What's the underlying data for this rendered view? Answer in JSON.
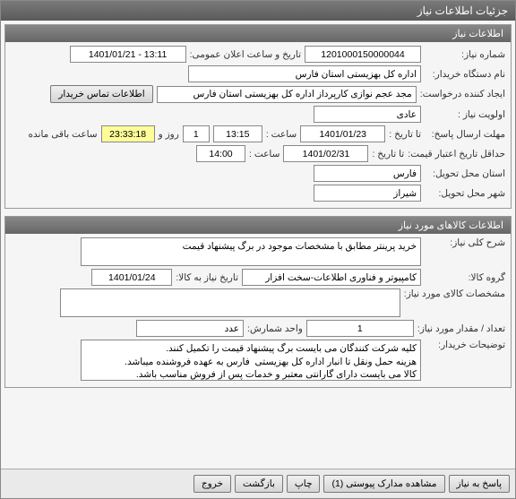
{
  "window": {
    "title": "جزئیات اطلاعات نیاز"
  },
  "section1": {
    "header": "اطلاعات نیاز",
    "need_number_label": "شماره نیاز:",
    "need_number": "1201000150000044",
    "announce_label": "تاریخ و ساعت اعلان عمومی:",
    "announce_value": "13:11 - 1401/01/21",
    "buyer_org_label": "نام دستگاه خریدار:",
    "buyer_org": "اداره کل بهزیستی استان فارس",
    "requester_label": "ایجاد کننده درخواست:",
    "requester": "مجد عجم نوازی کارپرداز اداره کل بهزیستی استان فارس",
    "contact_btn": "اطلاعات تماس خریدار",
    "priority_label": "اولویت نیاز :",
    "priority": "عادی",
    "reply_deadline_label": "مهلت ارسال پاسخ:",
    "to_date_label": "تا تاریخ :",
    "reply_date": "1401/01/23",
    "time_label": "ساعت :",
    "reply_time": "13:15",
    "days": "1",
    "days_label": "روز و",
    "remaining_time": "23:33:18",
    "remaining_label": "ساعت باقی مانده",
    "min_validity_label": "حداقل تاریخ اعتبار قیمت:",
    "validity_date": "1401/02/31",
    "validity_time": "14:00",
    "delivery_province_label": "استان محل تحویل:",
    "delivery_province": "فارس",
    "delivery_city_label": "شهر محل تحویل:",
    "delivery_city": "شیراز"
  },
  "section2": {
    "header": "اطلاعات کالاهای مورد نیاز",
    "overall_desc_label": "شرح کلی نیاز:",
    "overall_desc": "خرید پرینتر مطابق با مشخصات موجود در برگ پیشنهاد قیمت",
    "goods_group_label": "گروه کالا:",
    "goods_group": "کامپیوتر و فناوری اطلاعات-سخت افزار",
    "need_date_label": "تاریخ نیاز به کالا:",
    "need_date": "1401/01/24",
    "specs_label": "مشخصات کالای مورد نیاز:",
    "qty_label": "تعداد / مقدار مورد نیاز:",
    "qty": "1",
    "unit_label": "واحد شمارش:",
    "unit": "عدد",
    "buyer_notes_label": "توضیحات خریدار:",
    "buyer_notes": "کلیه شرکت کنندگان می بایست برگ پیشنهاد قیمت را تکمیل کنند.\nهزینه حمل ونقل تا انبار اداره کل بهزیستی  فارس به عهده فروشنده میباشد.\nکالا می بایست دارای گارانتی معتبر و خدمات پس از فروش مناسب باشد."
  },
  "footer": {
    "reply_btn": "پاسخ به نیاز",
    "attachments_btn": "مشاهده مدارک پیوستی (1)",
    "print_btn": "چاپ",
    "back_btn": "بازگشت",
    "exit_btn": "خروج"
  }
}
